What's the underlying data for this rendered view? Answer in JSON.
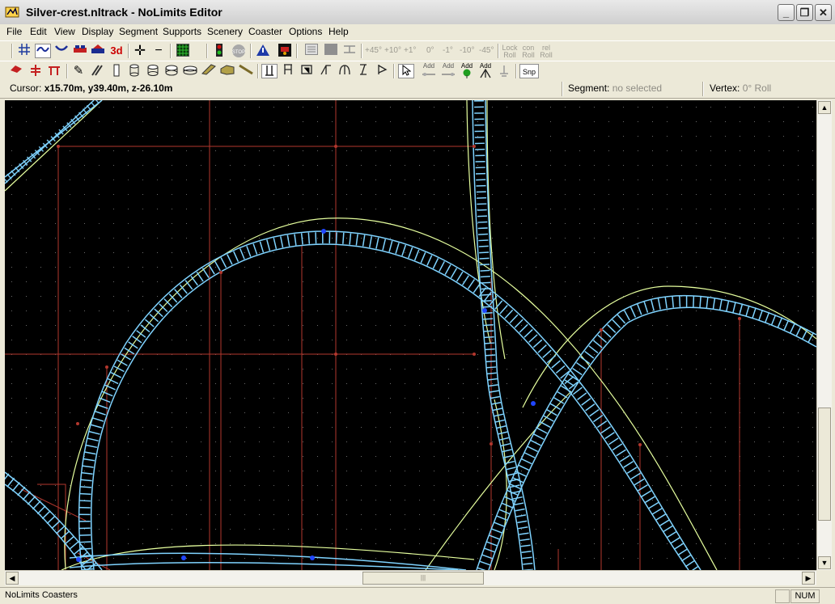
{
  "window": {
    "title": "Silver-crest.nltrack - NoLimits Editor"
  },
  "menu": [
    "File",
    "Edit",
    "View",
    "Display",
    "Segment",
    "Supports",
    "Scenery",
    "Coaster",
    "Options",
    "Help"
  ],
  "toolbar1": {
    "icons": [
      "grid-icon",
      "track-tool-icon",
      "track-curve-icon",
      "train-icon",
      "station-icon",
      "3d-view-icon",
      "add-node-icon",
      "remove-node-icon",
      "green-grid-icon",
      "traffic-light-icon",
      "stop-sign-icon",
      "warning-icon",
      "camera-icon",
      "list-icon",
      "block-icon",
      "align-icon"
    ],
    "three_d_label": "3d",
    "stop_label": "STOP",
    "roll_buttons": [
      "+45°",
      "+10°",
      "+1°",
      "0°",
      "-1°",
      "-10°",
      "-45°"
    ],
    "lock_roll": [
      "Lock",
      "Roll"
    ],
    "con_roll": [
      "con",
      "Roll"
    ],
    "rel_roll": [
      "rel",
      "Roll"
    ]
  },
  "toolbar2": {
    "add_labels": [
      "Add",
      "Add",
      "Add",
      "Add",
      "Add"
    ],
    "snap_label": "Snp"
  },
  "status": {
    "cursor_label": "Cursor:",
    "cursor_value": "x15.70m, y39.40m, z-26.10m",
    "segment_label": "Segment:",
    "segment_value": "no selected",
    "vertex_label": "Vertex:",
    "vertex_value": "0° Roll"
  },
  "bottom": {
    "app_status": "NoLimits Coasters",
    "num": "NUM"
  },
  "colors": {
    "track": "#7fd3ff",
    "guide": "#e6ff9e",
    "support": "#b3372e",
    "node": "#2046ff"
  }
}
